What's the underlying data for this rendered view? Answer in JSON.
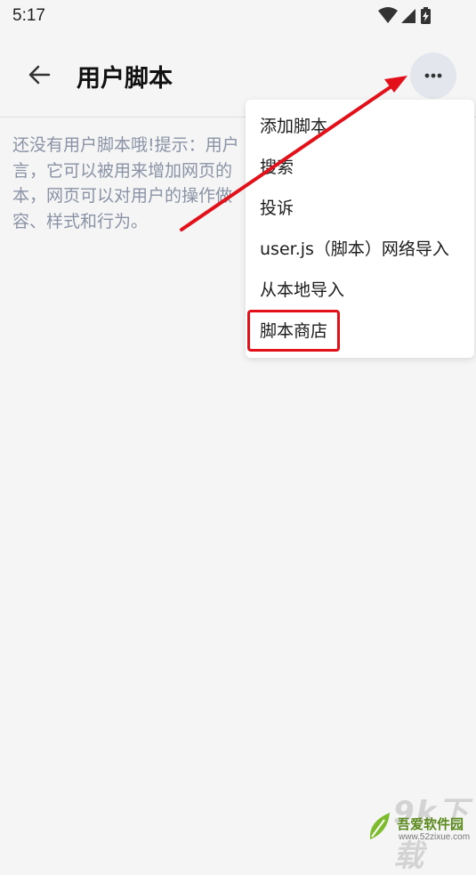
{
  "status_bar": {
    "time": "5:17",
    "icons": [
      "wifi-icon",
      "signal-icon",
      "battery-charging-icon"
    ]
  },
  "app_bar": {
    "back_icon": "arrow-left-icon",
    "title": "用户脚本",
    "more_icon": "more-horizontal-icon"
  },
  "empty_state": {
    "lines": [
      "还没有用户脚本哦!提示：用户",
      "言，它可以被用来增加网页的",
      "本，网页可以对用户的操作做",
      "容、样式和行为。"
    ]
  },
  "menu": {
    "items": [
      {
        "label": "添加脚本"
      },
      {
        "label": "搜索"
      },
      {
        "label": "投诉"
      },
      {
        "label": "user.js（脚本）网络导入"
      },
      {
        "label": "从本地导入"
      },
      {
        "label": "脚本商店"
      }
    ]
  },
  "annotations": {
    "color": "#e3101a",
    "highlighted_item": "脚本商店"
  },
  "watermark": {
    "big": "9k下载",
    "name": "吾爱软件园",
    "url": "www.52zixue.com"
  },
  "colors": {
    "background": "#f5f5f5",
    "more_button_bg": "#e4e6ee",
    "hint_text": "#8a93a5",
    "accent_red": "#e3101a"
  }
}
